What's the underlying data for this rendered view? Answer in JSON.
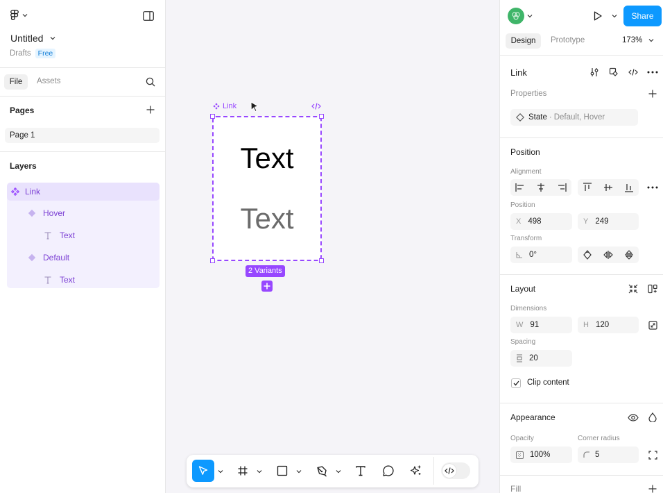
{
  "file": {
    "title": "Untitled",
    "location": "Drafts",
    "plan": "Free"
  },
  "left_tabs": {
    "file": "File",
    "assets": "Assets"
  },
  "pages": {
    "header": "Pages",
    "items": [
      "Page 1"
    ]
  },
  "layers": {
    "header": "Layers",
    "items": [
      {
        "label": "Link",
        "type": "component-set"
      },
      {
        "label": "Hover",
        "type": "variant"
      },
      {
        "label": "Text",
        "type": "text"
      },
      {
        "label": "Default",
        "type": "variant"
      },
      {
        "label": "Text",
        "type": "text"
      }
    ]
  },
  "canvas": {
    "frame_label": "Link",
    "texts": [
      "Text",
      "Text"
    ],
    "variants_badge": "2 Variants"
  },
  "toolbar": {
    "tools": [
      "move-tool",
      "frame-tool",
      "shape-tool",
      "pen-tool",
      "text-tool",
      "comment-tool",
      "actions-tool",
      "dev-mode-toggle"
    ]
  },
  "header_right": {
    "share": "Share",
    "zoom": "173%"
  },
  "right_tabs": {
    "design": "Design",
    "prototype": "Prototype"
  },
  "selection": {
    "name": "Link"
  },
  "properties": {
    "header": "Properties",
    "state_label": "State",
    "state_values": "Default, Hover"
  },
  "position": {
    "header": "Position",
    "alignment_label": "Alignment",
    "position_label": "Position",
    "x_label": "X",
    "x": "498",
    "y_label": "Y",
    "y": "249",
    "transform_label": "Transform",
    "rotation": "0°"
  },
  "layout": {
    "header": "Layout",
    "dimensions_label": "Dimensions",
    "w_label": "W",
    "w": "91",
    "h_label": "H",
    "h": "120",
    "spacing_label": "Spacing",
    "spacing": "20",
    "clip_content": "Clip content",
    "clip_checked": true
  },
  "appearance": {
    "header": "Appearance",
    "opacity_label": "Opacity",
    "opacity": "100%",
    "radius_label": "Corner radius",
    "radius": "5"
  },
  "fill": {
    "header": "Fill"
  },
  "colors": {
    "accent": "#0d99ff",
    "component": "#9747ff",
    "layer_text": "#7b3fd4",
    "selected_bg": "#e5f4ff"
  }
}
